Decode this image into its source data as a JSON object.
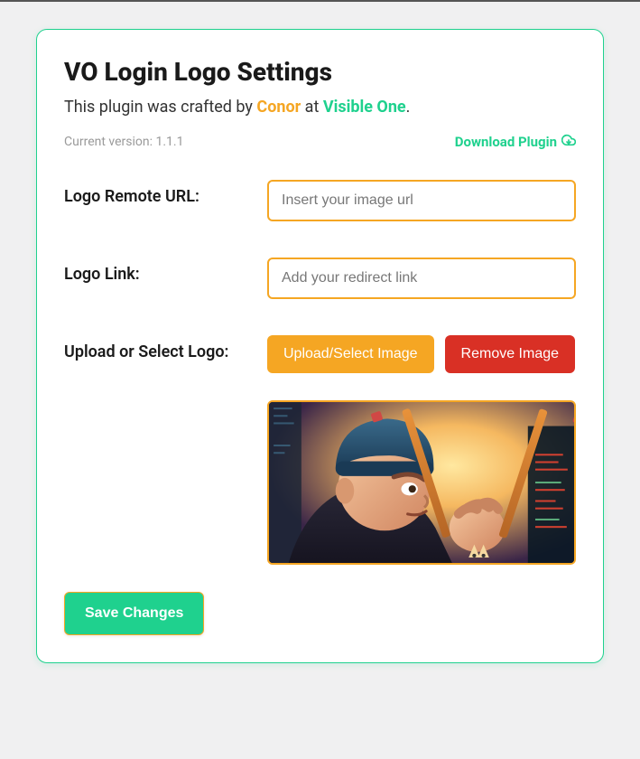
{
  "header": {
    "title": "VO Login Logo Settings",
    "credit_prefix": "This plugin was crafted by ",
    "author": "Conor",
    "credit_mid": " at ",
    "company": "Visible One",
    "credit_suffix": "."
  },
  "meta": {
    "version_label": "Current version: 1.1.1",
    "download_label": "Download Plugin"
  },
  "form": {
    "remote_url": {
      "label": "Logo Remote URL:",
      "placeholder": "Insert your image url",
      "value": ""
    },
    "logo_link": {
      "label": "Logo Link:",
      "placeholder": "Add your redirect link",
      "value": ""
    },
    "upload": {
      "label": "Upload or Select Logo:",
      "upload_button": "Upload/Select Image",
      "remove_button": "Remove Image"
    }
  },
  "actions": {
    "save": "Save Changes"
  }
}
